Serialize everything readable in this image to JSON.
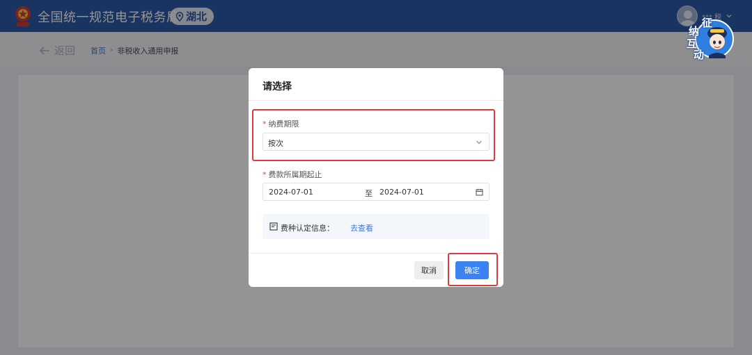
{
  "header": {
    "app_title": "全国统一规范电子税务局",
    "region": "湖北",
    "user_name": "*** 税"
  },
  "subbar": {
    "back_label": "返回",
    "breadcrumb": {
      "home": "首页",
      "separator": "›",
      "current": "非税收入通用申报"
    }
  },
  "mascot": {
    "chars": [
      "征",
      "纳",
      "互",
      "动"
    ]
  },
  "dialog": {
    "title": "请选择",
    "payment_period": {
      "label": "纳费期限",
      "required_mark": "*",
      "value": "按次"
    },
    "fee_period": {
      "label": "费款所属期起止",
      "required_mark": "*",
      "start": "2024-07-01",
      "separator": "至",
      "end": "2024-07-01"
    },
    "info": {
      "label": "费种认定信息：",
      "link": "去查看"
    },
    "buttons": {
      "cancel": "取消",
      "confirm": "确定"
    }
  },
  "colors": {
    "header_bg": "#2d5aa8",
    "primary": "#3c82f0",
    "link": "#3a78e0",
    "required": "#e5463d",
    "highlight": "#e03a3a"
  },
  "icons": [
    "tax-emblem-icon",
    "location-pin-icon",
    "user-avatar-icon",
    "chevron-down-icon",
    "arrow-left-icon",
    "calendar-icon",
    "document-icon"
  ]
}
